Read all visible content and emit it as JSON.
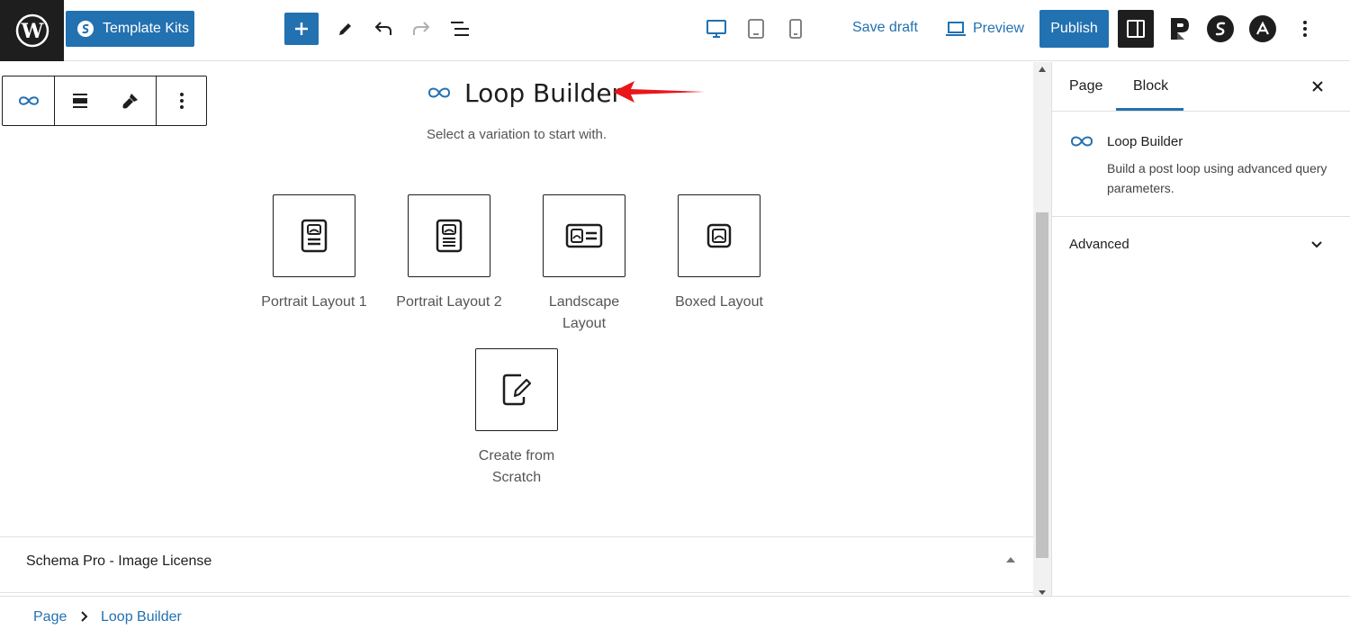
{
  "toolbar": {
    "template_kits_label": "Template Kits",
    "save_draft_label": "Save draft",
    "preview_label": "Preview",
    "publish_label": "Publish",
    "accent_color": "#2271b1"
  },
  "editor": {
    "block_title": "Loop Builder",
    "subtitle": "Select a variation to start with.",
    "variations": [
      {
        "label": "Portrait Layout 1",
        "icon": "portrait-layout-icon"
      },
      {
        "label": "Portrait Layout 2",
        "icon": "portrait-layout-icon"
      },
      {
        "label": "Landscape Layout",
        "icon": "landscape-layout-icon"
      },
      {
        "label": "Boxed Layout",
        "icon": "boxed-layout-icon"
      },
      {
        "label": "Create from Scratch",
        "icon": "edit-icon"
      }
    ]
  },
  "meta_box": {
    "title": "Schema Pro - Image License"
  },
  "sidebar": {
    "tabs": [
      "Page",
      "Block"
    ],
    "active_tab": "Block",
    "block_name": "Loop Builder",
    "block_description": "Build a post loop using advanced query parameters.",
    "advanced_label": "Advanced"
  },
  "breadcrumb": {
    "items": [
      "Page",
      "Loop Builder"
    ]
  }
}
